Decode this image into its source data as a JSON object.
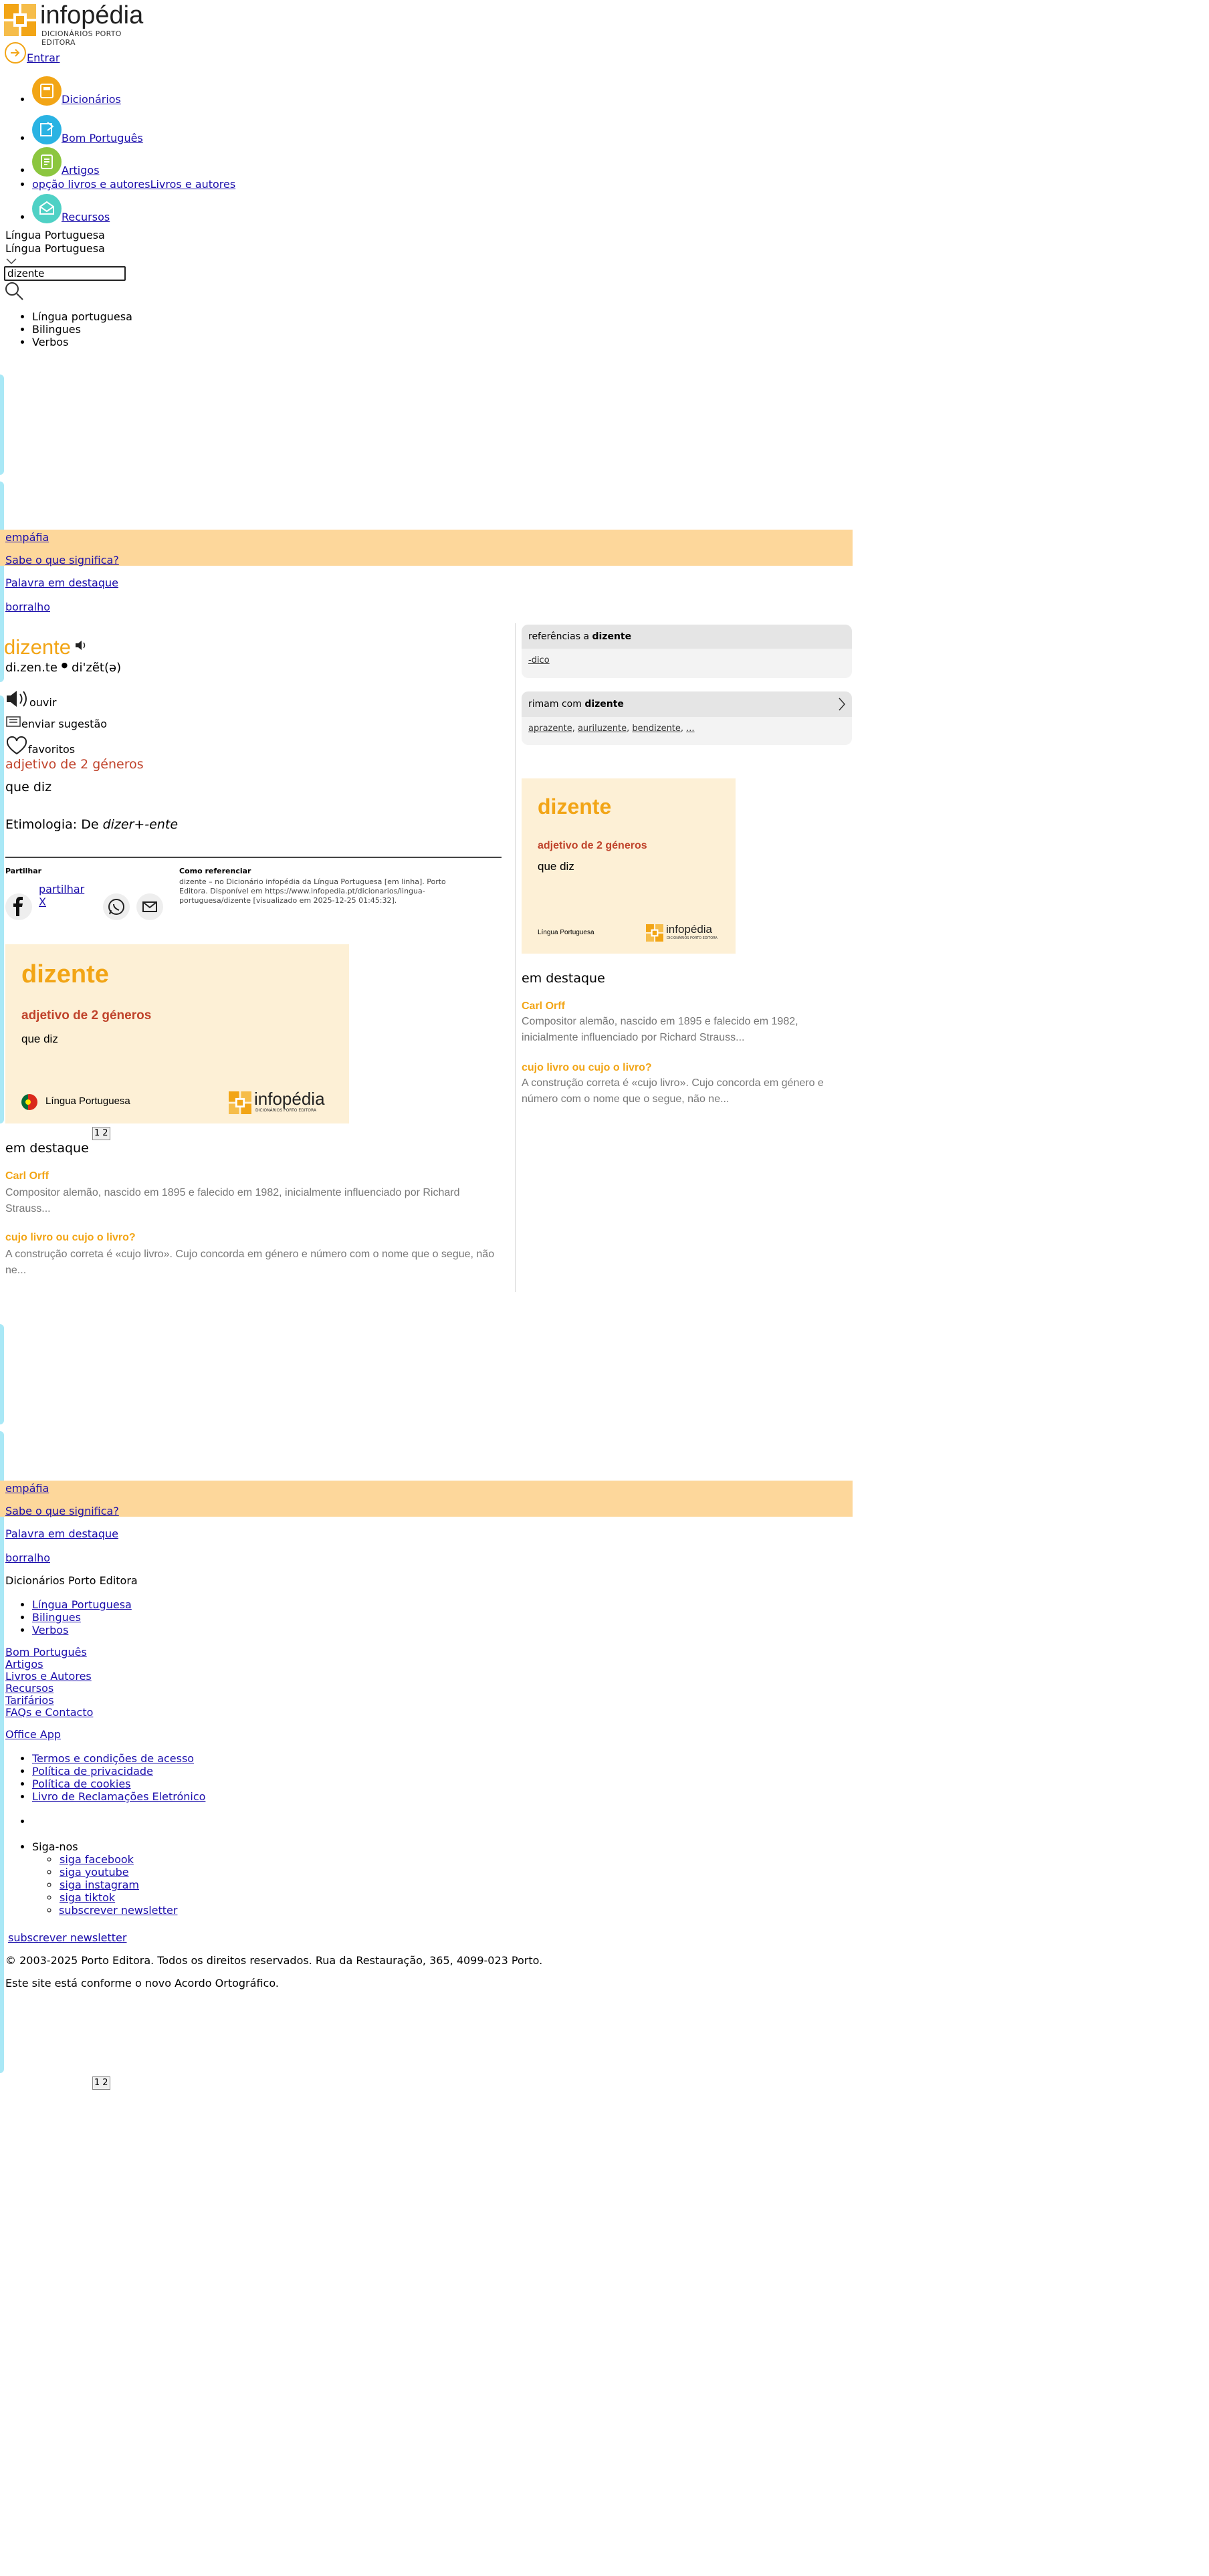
{
  "colors": {
    "brand_orange": "#f2a516",
    "type_red": "#c0432b",
    "banner_bg": "#fdd79b",
    "card_bg": "#fdf0d6",
    "ad_blue": "#a9e8f6"
  },
  "header": {
    "logo_name": "infopédia",
    "logo_sub": "DICIONÁRIOS PORTO EDITORA",
    "login_label": "Entrar",
    "nav": [
      {
        "label": "Dicionários",
        "icon": "dictionary-icon"
      },
      {
        "label": "Bom Português",
        "icon": "book-icon"
      },
      {
        "label": "Artigos",
        "icon": "article-icon"
      },
      {
        "label": "Livros e autores",
        "img_alt": "opção livros e autores"
      },
      {
        "label": "Recursos",
        "icon": "resources-icon"
      }
    ],
    "dict_selector": "Língua Portuguesa",
    "dict_selector_current": "Língua Portuguesa",
    "search_value": "dizente",
    "search_options": [
      "Língua portuguesa",
      "Bilingues",
      "Verbos"
    ]
  },
  "banner": {
    "word": "empáfia",
    "question": "Sabe o que significa?",
    "featured_label": "Palavra em destaque",
    "featured_word": "borralho"
  },
  "entry": {
    "word": "dizente",
    "syllables": "di.zen.te",
    "pronunciation": "di'zẽt(ə)",
    "listen_label": "ouvir",
    "suggest_label": "enviar sugestão",
    "favorites_label": "favoritos",
    "grammar": "adjetivo de 2 géneros",
    "definition": "que diz",
    "etymology_label": "Etimologia: De ",
    "etymology_value": "dizer+-ente"
  },
  "share": {
    "title": "Partilhar",
    "x_label": "partilhar X",
    "cite_title": "Como referenciar",
    "cite_text": "dizente – no Dicionário infopédia da Língua Portuguesa [em linha]. Porto Editora. Disponível em https://www.infopedia.pt/dicionarios/lingua-portuguesa/dizente [visualizado em 2025-12-25 01:45:32]."
  },
  "card": {
    "word": "dizente",
    "grammar": "adjetivo de 2 géneros",
    "definition": "que diz",
    "language": "Língua Portuguesa",
    "brand": "infopédia",
    "brand_sub": "DICIONÁRIOS PORTO EDITORA"
  },
  "pager": {
    "p1": "1",
    "p2": "2"
  },
  "highlights": {
    "title": "em destaque",
    "items": [
      {
        "title": "Carl Orff",
        "text": "Compositor alemão, nascido em 1895 e falecido em 1982, inicialmente influenciado por Richard Strauss..."
      },
      {
        "title": "cujo livro ou cujo o livro?",
        "text": "A construção correta é «cujo livro». Cujo concorda em género e número com o nome que o segue, não ne..."
      }
    ]
  },
  "sidebar": {
    "refs_prefix": "referências a ",
    "refs_word": "dizente",
    "refs_links": [
      "-dico"
    ],
    "rhymes_prefix": "rimam com ",
    "rhymes_word": "dizente",
    "rhymes_links": [
      "aprazente",
      "auriluzente",
      "bendizente",
      "..."
    ]
  },
  "footer": {
    "title": "Dicionários Porto Editora",
    "dict_links": [
      "Língua Portuguesa",
      "Bilingues",
      "Verbos"
    ],
    "links": [
      "Bom Português",
      "Artigos",
      "Livros e Autores",
      "Recursos",
      "Tarifários",
      "FAQs e Contacto"
    ],
    "office_app": "Office App",
    "legal_links": [
      "Termos e condições de acesso",
      "Política de privacidade",
      "Política de cookies",
      "Livro de Reclamações Eletrónico"
    ],
    "follow_label": "Siga-nos",
    "social": [
      "siga facebook",
      "siga youtube",
      "siga instagram",
      "siga tiktok"
    ],
    "newsletter": "subscrever newsletter",
    "newsletter2": "subscrever newsletter",
    "copyright": "© 2003-2025 Porto Editora. Todos os direitos reservados. Rua da Restauração, 365, 4099-023 Porto.",
    "agreement": "Este site está conforme o novo Acordo Ortográfico."
  }
}
